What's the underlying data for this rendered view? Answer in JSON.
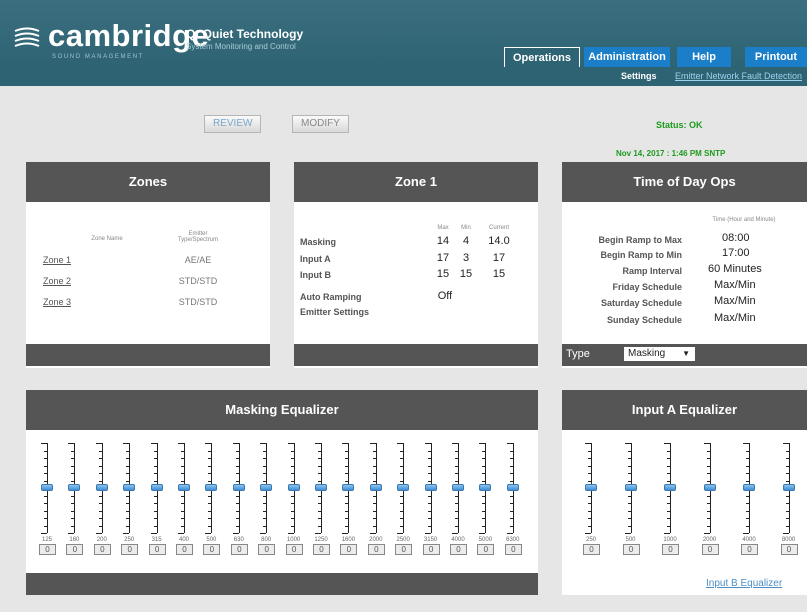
{
  "header": {
    "brand": "cambridge",
    "brand_sub": "SOUND MANAGEMENT",
    "product": "Qt Quiet Technology",
    "product_sub": "System Monitoring and Control",
    "tabs": [
      "Operations",
      "Administration",
      "Help",
      "Printout"
    ],
    "active_tab": "Operations"
  },
  "subnav": {
    "settings": "Settings",
    "fault": "Emitter Network Fault Detection"
  },
  "actions": {
    "review": "REVIEW",
    "modify": "MODIFY"
  },
  "status": {
    "label": "Status: OK",
    "date": "Nov 14, 2017 : 1:46 PM SNTP"
  },
  "zones": {
    "title": "Zones",
    "col_name": "Zone Name",
    "col_type": "Emitter Type/Spectrum",
    "rows": [
      {
        "zone": "Zone 1",
        "name": "",
        "type": "AE/AE"
      },
      {
        "zone": "Zone 2",
        "name": "",
        "type": "STD/STD"
      },
      {
        "zone": "Zone 3",
        "name": "",
        "type": "STD/STD"
      }
    ]
  },
  "zone1": {
    "title": "Zone 1",
    "col_max": "Max",
    "col_min": "Min",
    "col_current": "Current",
    "rows": [
      {
        "label": "Masking",
        "max": "14",
        "min": "4",
        "current": "14.0"
      },
      {
        "label": "Input A",
        "max": "17",
        "min": "3",
        "current": "17"
      },
      {
        "label": "Input B",
        "max": "15",
        "min": "15",
        "current": "15"
      }
    ],
    "auto_ramping_label": "Auto Ramping",
    "auto_ramping_value": "Off",
    "emitter_settings": "Emitter Settings"
  },
  "tod": {
    "title": "Time of Day Ops",
    "col_time": "Time (Hour and Minute)",
    "rows": [
      {
        "label": "Begin Ramp to Max",
        "value": "08:00"
      },
      {
        "label": "Begin Ramp to Min",
        "value": "17:00"
      },
      {
        "label": "Ramp Interval",
        "value": "60 Minutes"
      },
      {
        "label": "Friday Schedule",
        "value": "Max/Min"
      },
      {
        "label": "Saturday Schedule",
        "value": "Max/Min"
      },
      {
        "label": "Sunday Schedule",
        "value": "Max/Min"
      }
    ],
    "type_label": "Type",
    "type_value": "Masking"
  },
  "masking_eq": {
    "title": "Masking Equalizer",
    "bands": [
      {
        "freq": "125",
        "value": "0"
      },
      {
        "freq": "160",
        "value": "0"
      },
      {
        "freq": "200",
        "value": "0"
      },
      {
        "freq": "250",
        "value": "0"
      },
      {
        "freq": "315",
        "value": "0"
      },
      {
        "freq": "400",
        "value": "0"
      },
      {
        "freq": "500",
        "value": "0"
      },
      {
        "freq": "630",
        "value": "0"
      },
      {
        "freq": "800",
        "value": "0"
      },
      {
        "freq": "1000",
        "value": "0"
      },
      {
        "freq": "1250",
        "value": "0"
      },
      {
        "freq": "1600",
        "value": "0"
      },
      {
        "freq": "2000",
        "value": "0"
      },
      {
        "freq": "2500",
        "value": "0"
      },
      {
        "freq": "3150",
        "value": "0"
      },
      {
        "freq": "4000",
        "value": "0"
      },
      {
        "freq": "5000",
        "value": "0"
      },
      {
        "freq": "6300",
        "value": "0"
      }
    ]
  },
  "input_a_eq": {
    "title": "Input A Equalizer",
    "bands": [
      {
        "freq": "250",
        "value": "0"
      },
      {
        "freq": "500",
        "value": "0"
      },
      {
        "freq": "1000",
        "value": "0"
      },
      {
        "freq": "2000",
        "value": "0"
      },
      {
        "freq": "4000",
        "value": "0"
      },
      {
        "freq": "8000",
        "value": "0"
      }
    ],
    "footer_link": "Input B Equalizer"
  }
}
